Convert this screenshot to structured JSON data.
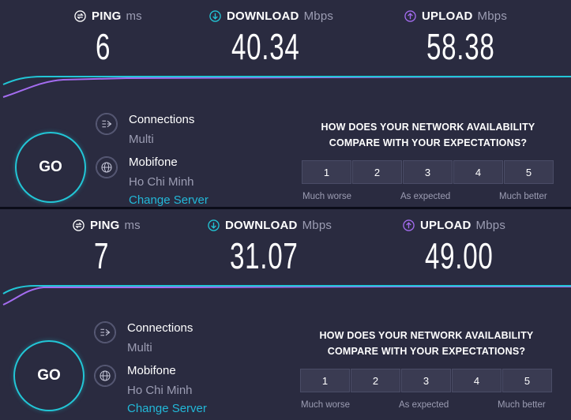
{
  "labels": {
    "ping": "PING",
    "ping_unit": "ms",
    "download": "DOWNLOAD",
    "download_unit": "Mbps",
    "upload": "UPLOAD",
    "upload_unit": "Mbps",
    "go": "GO",
    "connections": "Connections",
    "connections_value": "Multi",
    "isp": "Mobifone",
    "location": "Ho Chi Minh",
    "change_server": "Change Server",
    "question_line1": "HOW DOES YOUR NETWORK AVAILABILITY",
    "question_line2": "COMPARE WITH YOUR EXPECTATIONS?",
    "ratings": [
      "1",
      "2",
      "3",
      "4",
      "5"
    ],
    "much_worse": "Much worse",
    "as_expected": "As expected",
    "much_better": "Much better"
  },
  "results": [
    {
      "ping": "6",
      "download": "40.34",
      "upload": "58.38"
    },
    {
      "ping": "7",
      "download": "31.07",
      "upload": "49.00"
    }
  ],
  "colors": {
    "panel_bg": "#2a2b40",
    "download_accent": "#22c6d6",
    "upload_accent": "#a46cf0",
    "link": "#22b8d8",
    "muted_text": "#9c9db3"
  },
  "icons": {
    "ping": "ping-icon",
    "download": "download-arrow-icon",
    "upload": "upload-arrow-icon",
    "connections": "connections-icon",
    "server": "globe-icon"
  }
}
